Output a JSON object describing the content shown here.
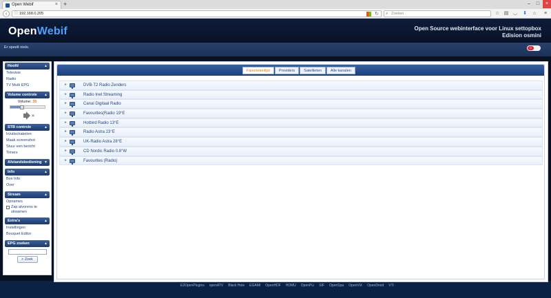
{
  "browser": {
    "tab_title": "Open Webif",
    "url": "192.168.0.205",
    "search_placeholder": "Zoeken"
  },
  "header": {
    "logo_part1": "Open",
    "logo_part2": "Webif",
    "tagline_line1": "Open Source webinterface voor Linux settopbox",
    "tagline_line2": "Edision osmini"
  },
  "status": {
    "now_playing": "Er speelt niets.",
    "toggle_label": "0"
  },
  "sidebar": {
    "hoofd": {
      "title": "Hoofd",
      "items": [
        "Televisie",
        "Radio",
        "TV Multi EPG"
      ]
    },
    "volume": {
      "title": "Volume controle",
      "label": "Volume:",
      "value": "35",
      "level": 0.35
    },
    "stb": {
      "title": "STB controle",
      "items": [
        "In/uitschakelen",
        "Maak screenshot",
        "Stuur een bericht",
        "Timers"
      ]
    },
    "remote": {
      "title": "Afstandsbediening"
    },
    "info": {
      "title": "Info",
      "items": [
        "Box Info",
        "Over"
      ]
    },
    "stream": {
      "title": "Stream",
      "items": [
        "Opnames"
      ],
      "checkbox_label": "Zap alvorens te streamen"
    },
    "extras": {
      "title": "Extra's",
      "items": [
        "Instellingen",
        "Bouquet Editor"
      ]
    },
    "epg": {
      "title": "EPG zoeken",
      "button": "Zoek"
    }
  },
  "main": {
    "tabs": [
      "Favorietenlijst",
      "Providers",
      "Satellieten",
      "Alle kanalen"
    ],
    "active_tab": "Favorietenlijst",
    "bouquets": [
      "DVB-T2 Radio Zenders",
      "Radio Inet Streaming",
      "Canal Digitaal Radio",
      "Favourites(Radio 19°E",
      "Hotbird Radio 13°E",
      "Radio Astra 23°E",
      "UK-Radio Astra 28°E",
      "CD Nordic Radio 0.8°W",
      "Favourites (Radio)"
    ]
  },
  "footer": {
    "links": [
      "E2OpenPlugins",
      "openATV",
      "Black Hole",
      "EGAMI",
      "OpenHDF",
      "HDMU",
      "OpenPLi",
      "SIF",
      "OpenSpa",
      "OpenViX",
      "OpenDroid",
      "VTi"
    ]
  }
}
